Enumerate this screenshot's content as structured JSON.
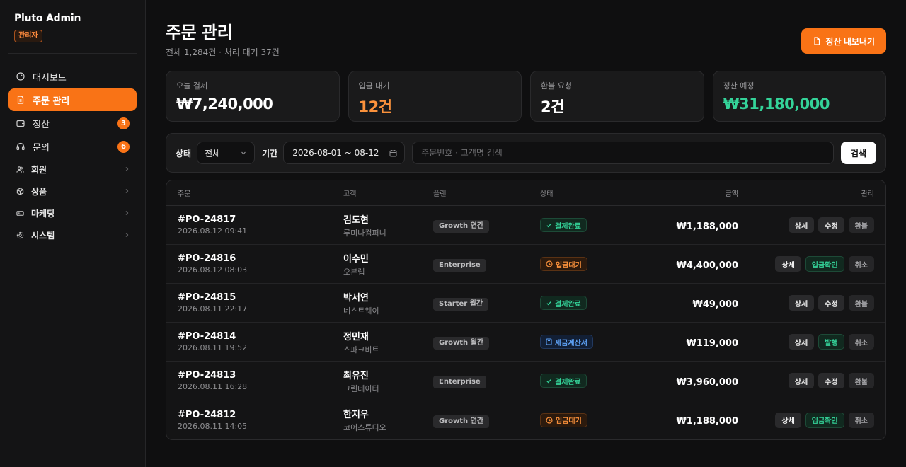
{
  "sidebar": {
    "brand": "Pluto Admin",
    "role": "관리자",
    "items": [
      {
        "label": "대시보드",
        "icon": "dashboard-icon",
        "active": false,
        "count": ""
      },
      {
        "label": "주문 관리",
        "icon": "order-icon",
        "active": true,
        "count": ""
      },
      {
        "label": "정산",
        "icon": "wallet-icon",
        "active": false,
        "count": "3"
      },
      {
        "label": "문의",
        "icon": "headset-icon",
        "active": false,
        "count": "6"
      }
    ],
    "groups": [
      {
        "label": "회원",
        "icon": "users-icon"
      },
      {
        "label": "상품",
        "icon": "box-icon"
      },
      {
        "label": "마케팅",
        "icon": "megaphone-icon"
      },
      {
        "label": "시스템",
        "icon": "gear-icon"
      }
    ]
  },
  "header": {
    "title": "주문 관리",
    "subtitle": "전체 1,284건 · 처리 대기 37건",
    "export_label": "정산 내보내기"
  },
  "stats": [
    {
      "label": "오늘 결제",
      "value": "₩7,240,000",
      "color": "#ffffff"
    },
    {
      "label": "입금 대기",
      "value": "12건",
      "color": "#fb923c"
    },
    {
      "label": "환불 요청",
      "value": "2건",
      "color": "#ffffff"
    },
    {
      "label": "정산 예정",
      "value": "₩31,180,000",
      "color": "#34d399"
    }
  ],
  "filters": {
    "status_label": "상태",
    "status_value": "전체",
    "period_label": "기간",
    "period_value": "2026-08-01 ~ 08-12",
    "search_placeholder": "주문번호 · 고객명 검색",
    "search_button": "검색"
  },
  "table": {
    "headers": {
      "order": "주문",
      "customer": "고객",
      "plan": "플랜",
      "status": "상태",
      "amount": "금액",
      "actions": "관리"
    },
    "rows": [
      {
        "id": "#PO-24817",
        "date": "2026.08.12 09:41",
        "name": "김도현",
        "company": "루미나컴퍼니",
        "plan": "Growth 연간",
        "status": "결제완료",
        "status_type": "green",
        "amount": "₩1,188,000",
        "actions": [
          "상세",
          "수정",
          "환불"
        ]
      },
      {
        "id": "#PO-24816",
        "date": "2026.08.12 08:03",
        "name": "이수민",
        "company": "오븐랩",
        "plan": "Enterprise",
        "status": "입금대기",
        "status_type": "orange",
        "amount": "₩4,400,000",
        "actions": [
          "상세",
          "입금확인",
          "취소"
        ]
      },
      {
        "id": "#PO-24815",
        "date": "2026.08.11 22:17",
        "name": "박서연",
        "company": "네스트웨이",
        "plan": "Starter 월간",
        "status": "결제완료",
        "status_type": "green",
        "amount": "₩49,000",
        "actions": [
          "상세",
          "수정",
          "환불"
        ]
      },
      {
        "id": "#PO-24814",
        "date": "2026.08.11 19:52",
        "name": "정민재",
        "company": "스파크비트",
        "plan": "Growth 월간",
        "status": "세금계산서",
        "status_type": "blue",
        "amount": "₩119,000",
        "actions": [
          "상세",
          "발행",
          "취소"
        ]
      },
      {
        "id": "#PO-24813",
        "date": "2026.08.11 16:28",
        "name": "최유진",
        "company": "그린데이터",
        "plan": "Enterprise",
        "status": "결제완료",
        "status_type": "green",
        "amount": "₩3,960,000",
        "actions": [
          "상세",
          "수정",
          "환불"
        ]
      },
      {
        "id": "#PO-24812",
        "date": "2026.08.11 14:05",
        "name": "한지우",
        "company": "코어스튜디오",
        "plan": "Growth 연간",
        "status": "입금대기",
        "status_type": "orange",
        "amount": "₩1,188,000",
        "actions": [
          "상세",
          "입금확인",
          "취소"
        ]
      }
    ]
  }
}
